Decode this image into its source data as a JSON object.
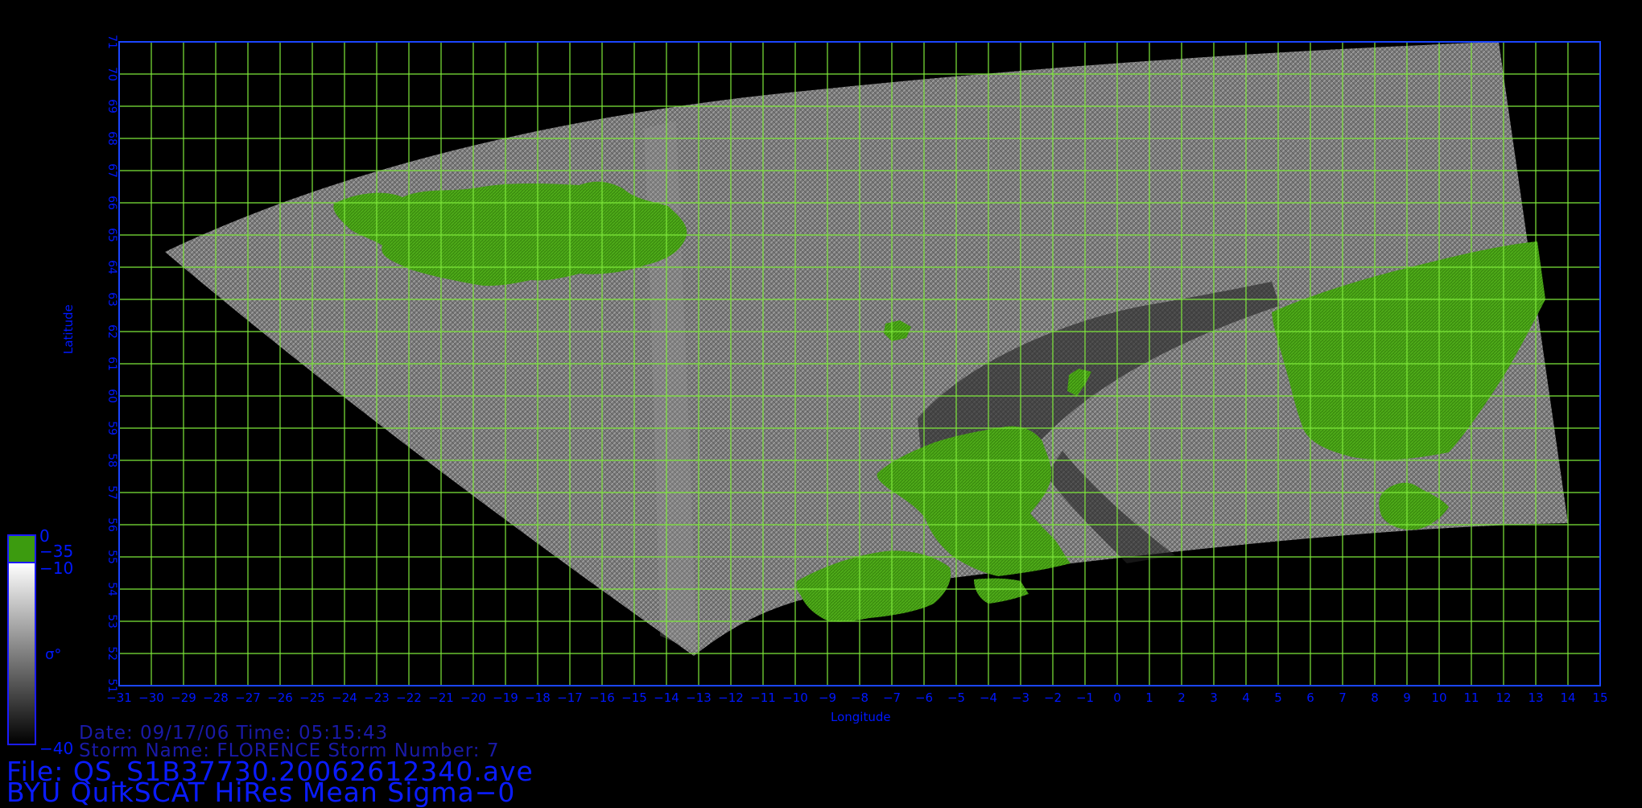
{
  "plot": {
    "xlabel": "Longitude",
    "ylabel": "Latitude",
    "lon_range": [
      -31,
      15
    ],
    "lat_range": [
      51,
      71
    ],
    "lon_ticks": [
      -31,
      -30,
      -29,
      -28,
      -27,
      -26,
      -25,
      -24,
      -23,
      -22,
      -21,
      -20,
      -19,
      -18,
      -17,
      -16,
      -15,
      -14,
      -13,
      -12,
      -11,
      -10,
      -9,
      -8,
      -7,
      -6,
      -5,
      -4,
      -3,
      -2,
      -1,
      0,
      1,
      2,
      3,
      4,
      5,
      6,
      7,
      8,
      9,
      10,
      11,
      12,
      13,
      14,
      15
    ],
    "lat_ticks": [
      51,
      52,
      53,
      54,
      55,
      56,
      57,
      58,
      59,
      60,
      61,
      62,
      63,
      64,
      65,
      66,
      67,
      68,
      69,
      70,
      71
    ],
    "grid": true,
    "colors": {
      "grid": "#7ee83a",
      "frame": "#1b46ff",
      "label": "#0018ff",
      "land": "#3f8a12"
    }
  },
  "colorbar": {
    "symbol": "σ°",
    "land_label": "0",
    "labels": [
      "−35",
      "−10",
      "−40"
    ],
    "land_color": "#3c9b0f"
  },
  "info": {
    "date_line": "Date: 09/17/06  Time: 05:15:43",
    "storm_line": "Storm Name: FLORENCE  Storm Number: 7",
    "file_line": "File: QS_S1B37730.20062612340.ave",
    "product_line": "BYU QuikSCAT HiRes Mean Sigma−0"
  }
}
